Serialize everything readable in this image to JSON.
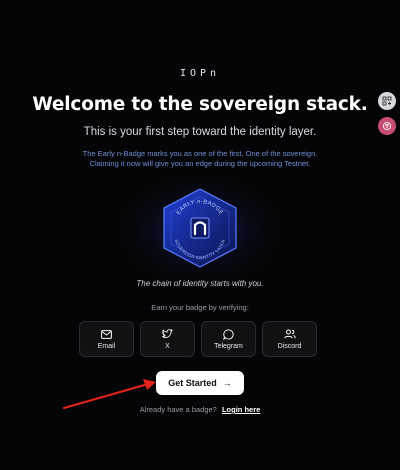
{
  "brand": {
    "logo_text": "IOPn"
  },
  "hero": {
    "title": "Welcome to the sovereign stack.",
    "subtitle": "This is your first step toward the identity layer.",
    "description_line1": "The Early n-Badge marks you as one of the first. One of the sovereign.",
    "description_line2": "Claiming it now will give you an edge during the upcoming Testnet."
  },
  "badge": {
    "top_text": "EARLY n-BADGE",
    "bottom_text": "SOVEREIGN IDENTITY LAYER",
    "accent_color": "#2f5bff"
  },
  "tagline": "The chain of identity starts with you.",
  "verify": {
    "heading": "Earn your badge by verifying:",
    "options": [
      {
        "label": "Email",
        "icon": "mail-icon"
      },
      {
        "label": "X",
        "icon": "twitter-bird-icon"
      },
      {
        "label": "Telegram",
        "icon": "chat-bubble-icon"
      },
      {
        "label": "Discord",
        "icon": "users-icon"
      }
    ]
  },
  "cta": {
    "label": "Get Started",
    "arrow": "→"
  },
  "login": {
    "prompt": "Already have a badge?",
    "link": "Login here"
  },
  "colors": {
    "background": "#050507",
    "annotation_arrow": "#e0241b",
    "side_icon_2": "#c84d72"
  }
}
